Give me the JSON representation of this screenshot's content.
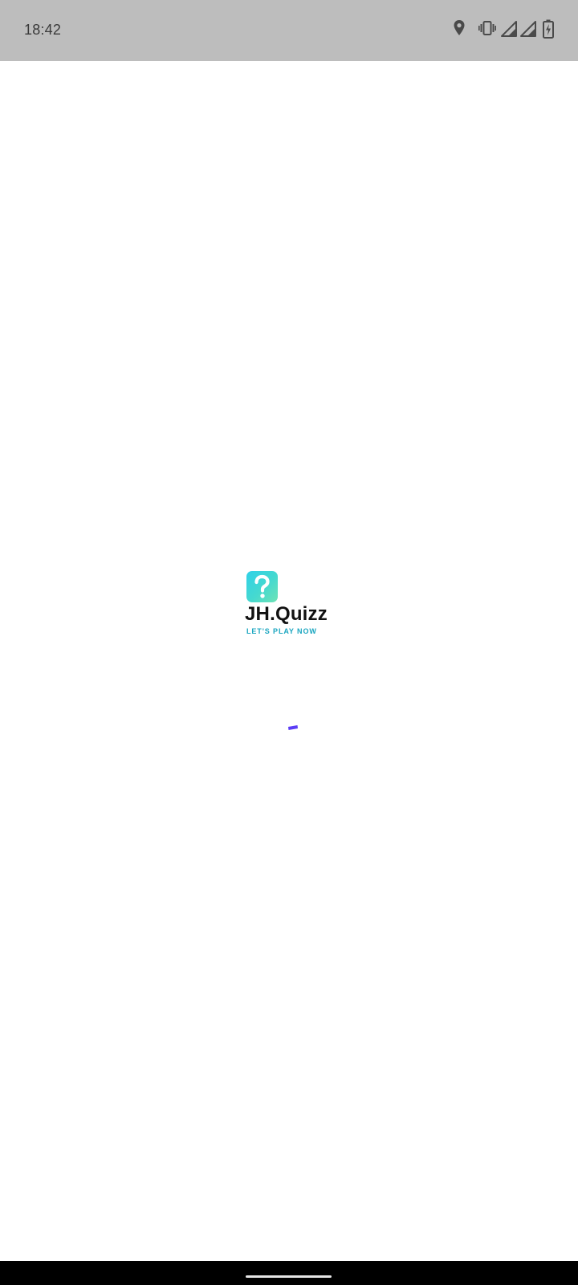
{
  "status_bar": {
    "time": "18:42",
    "icons": [
      "location-icon",
      "vibrate-icon",
      "signal-icon",
      "signal-icon",
      "battery-charging-icon"
    ],
    "background": "#bdbdbd"
  },
  "splash": {
    "app_name": "JH.Quizz",
    "tagline": "LET'S PLAY NOW",
    "logo_icon": "question-mark-icon",
    "logo_gradient": [
      "#2fd1e8",
      "#6fe3b5"
    ],
    "tagline_color": "#1aa6c0",
    "loading_indicator": "progress-spinner",
    "loading_color": "#5b3df5"
  },
  "nav_bar": {
    "background": "#000000"
  }
}
